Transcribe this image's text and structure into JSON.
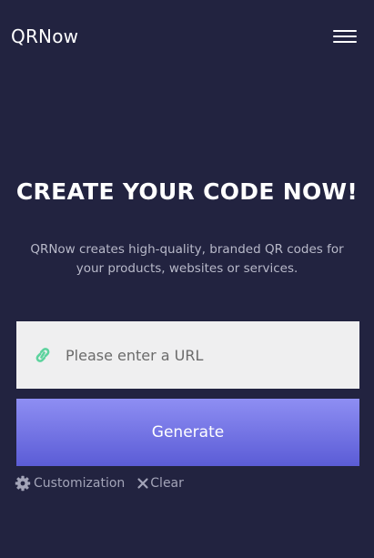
{
  "header": {
    "brand": "QRNow",
    "menu_icon": "hamburger-menu-icon"
  },
  "hero": {
    "title": "CREATE YOUR CODE NOW!",
    "description": "QRNow creates high-quality, branded QR codes for your products, websites or services."
  },
  "url_input": {
    "icon": "link-icon",
    "placeholder": "Please enter a URL",
    "value": ""
  },
  "generate_button": {
    "label": "Generate"
  },
  "options": {
    "customization": {
      "icon": "gear-icon",
      "label": "Customization"
    },
    "clear": {
      "icon": "close-icon",
      "label": "Clear"
    }
  },
  "colors": {
    "background": "#222340",
    "accent_top": "#8e8ef3",
    "accent_bottom": "#5b5cd6",
    "link_icon": "#5dd39e",
    "muted_text": "#a3a4b8"
  }
}
